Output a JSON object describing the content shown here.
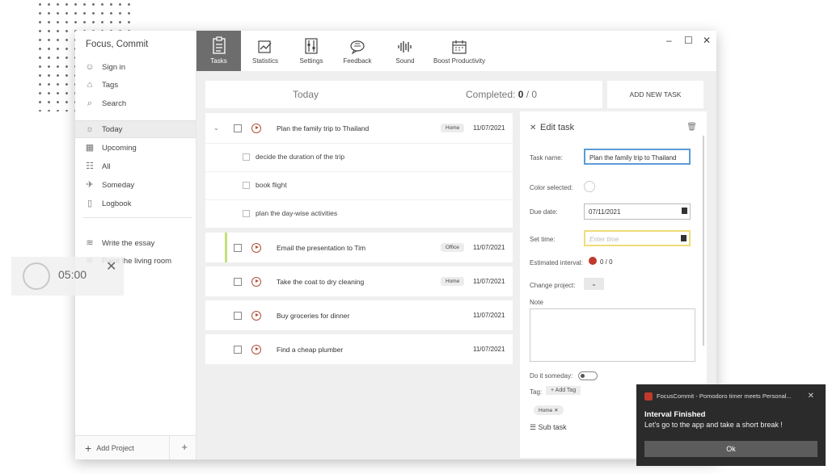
{
  "sidebar": {
    "app_title": "Focus, Commit",
    "sign_in": "Sign in",
    "tags": "Tags",
    "search": "Search",
    "items": [
      {
        "label": "Today"
      },
      {
        "label": "Upcoming"
      },
      {
        "label": "All"
      },
      {
        "label": "Someday"
      },
      {
        "label": "Logbook"
      }
    ],
    "projects": [
      {
        "label": "Write the essay"
      },
      {
        "label": "Paint the living room"
      }
    ],
    "add_project": "Add Project"
  },
  "toolbar": {
    "tabs": [
      {
        "label": "Tasks"
      },
      {
        "label": "Statistics"
      },
      {
        "label": "Settings"
      },
      {
        "label": "Feedback"
      },
      {
        "label": "Sound"
      },
      {
        "label": "Boost Productivity"
      }
    ]
  },
  "header": {
    "today": "Today",
    "completed_label": "Completed:",
    "completed_done": "0",
    "completed_total": "/ 0",
    "add_task": "ADD NEW TASK"
  },
  "tasks": [
    {
      "name": "Plan the family trip to Thailand",
      "tag": "Home",
      "date": "11/07/2021",
      "subtasks": [
        "decide the duration of the trip",
        "book flight",
        "plan the day-wise activities"
      ]
    },
    {
      "name": "Email the presentation to Tim",
      "tag": "Office",
      "date": "11/07/2021"
    },
    {
      "name": "Take the coat to dry cleaning",
      "tag": "Home",
      "date": "11/07/2021"
    },
    {
      "name": "Buy groceries for dinner",
      "tag": "",
      "date": "11/07/2021"
    },
    {
      "name": "Find a cheap plumber",
      "tag": "",
      "date": "11/07/2021"
    }
  ],
  "edit_task": {
    "title": "Edit task",
    "task_name_label": "Task name:",
    "task_name_value": "Plan the family trip to Thailand",
    "color_label": "Color selected:",
    "due_label": "Due date:",
    "due_value": "07/11/2021",
    "time_label": "Set time:",
    "time_placeholder": "Enter time",
    "interval_label": "Estimated interval:",
    "interval_value": "0 / 0",
    "project_label": "Change project:",
    "note_label": "Note",
    "someday_label": "Do it someday:",
    "tag_label": "Tag:",
    "add_tag": "+ Add Tag",
    "tag_chip": "Home",
    "subtask_label": "Sub task"
  },
  "timer": {
    "value": "05:00"
  },
  "toast": {
    "app": "FocusCommit - Pomodoro timer meets Personal...",
    "heading": "Interval Finished",
    "body": "Let's go to the app and take a short break !",
    "button": "Ok"
  },
  "colors": {
    "active_tab": "#6d6d6d",
    "accent_green": "#c4e07a",
    "pomodoro_red": "#b0503c",
    "input_blue": "#5b9bd5"
  }
}
